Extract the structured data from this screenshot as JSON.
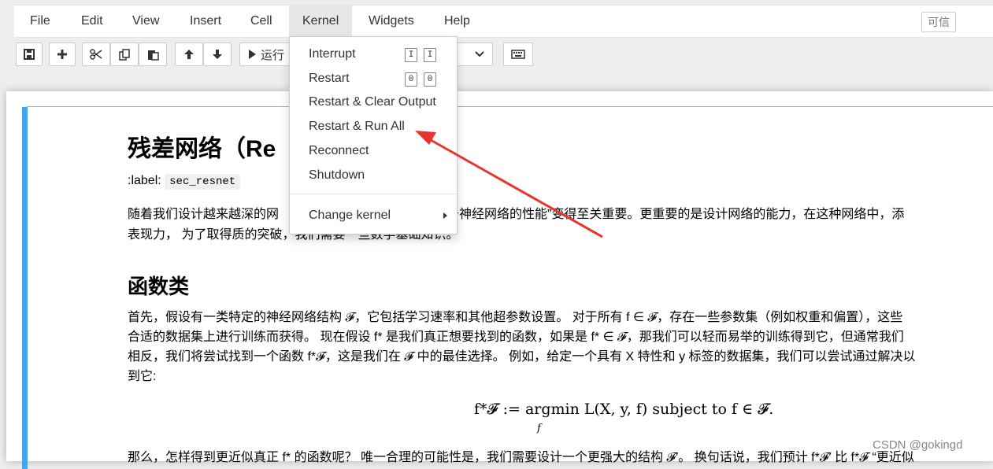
{
  "menubar": {
    "items": [
      "File",
      "Edit",
      "View",
      "Insert",
      "Cell",
      "Kernel",
      "Widgets",
      "Help"
    ],
    "active": "Kernel",
    "trusted_label": "可信"
  },
  "toolbar": {
    "run_label": "运行"
  },
  "kernel_menu": {
    "items": [
      {
        "label": "Interrupt",
        "shortcut": [
          "I",
          "I"
        ]
      },
      {
        "label": "Restart",
        "shortcut": [
          "0",
          "0"
        ]
      },
      {
        "label": "Restart & Clear Output"
      },
      {
        "label": "Restart & Run All"
      },
      {
        "label": "Reconnect"
      },
      {
        "label": "Shutdown"
      },
      {
        "label": "Change kernel"
      }
    ]
  },
  "notebook": {
    "title": "残差网络（Re",
    "label_prefix": ":label:",
    "label_code": "sec_resnet",
    "para1_line1_a": "随着我们设计越来越深的网",
    "para1_line1_b": "如何提升神经网络的性能”变得至关重要。更重要的是设计网络的能力，在这种网络中，添",
    "para1_line2_a": "表现力，  为了取得质的突破，",
    "para1_line2_b": "我们需要一些数学基础知识。",
    "section_title": "函数类",
    "para2_line1": "首先，假设有一类特定的神经网络结构 𝓕，它包括学习速率和其他超参数设置。 对于所有 f ∈ 𝓕，存在一些参数集（例如权重和偏置），这些",
    "para2_line2": "合适的数据集上进行训练而获得。 现在假设 f* 是我们真正想要找到的函数，如果是 f* ∈ 𝓕，那我们可以轻而易举的训练得到它，但通常我们",
    "para2_line3": "相反，我们将尝试找到一个函数 f*𝓕，这是我们在 𝓕 中的最佳选择。 例如，给定一个具有 X 特性和 y 标签的数据集，我们可以尝试通过解决以",
    "para2_line4": "到它:",
    "formula": "f*𝓕 := argmin L(X, y, f) subject to f ∈ 𝓕.",
    "formula_sub": "f",
    "para3_line1": "那么，怎样得到更近似真正 f* 的函数呢？ 唯一合理的可能性是，我们需要设计一个更强大的结构 𝓕′。 换句话说，我们预计 f*𝓕′ 比 f*𝓕 “更近似"
  },
  "watermark": "CSDN @gokingd",
  "colors": {
    "cell_bar": "#42a5f5",
    "annotation_arrow": "#e8332e"
  }
}
